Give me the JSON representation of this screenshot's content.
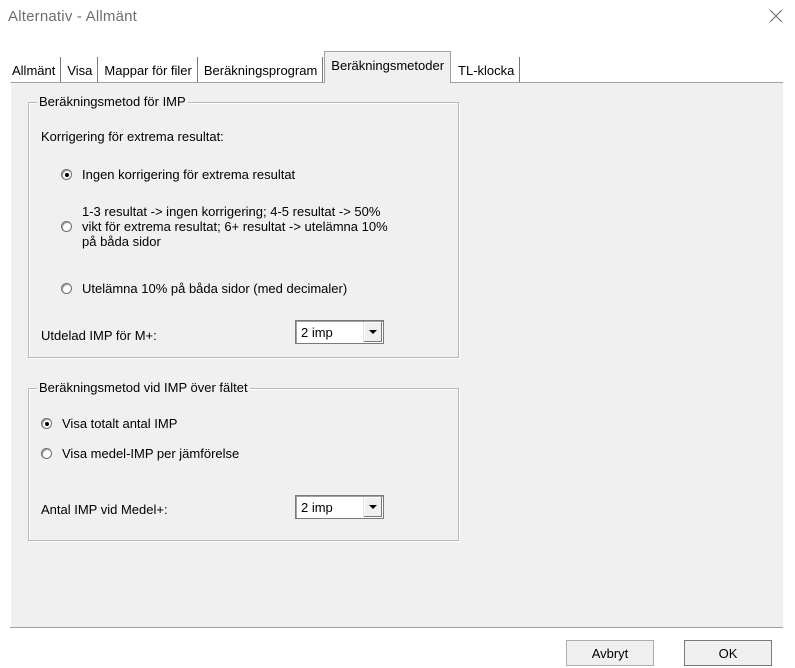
{
  "window": {
    "title": "Alternativ - Allmänt",
    "close_glyph": "✕"
  },
  "tabs": [
    {
      "label": "Allmänt",
      "active": false
    },
    {
      "label": "Visa",
      "active": false
    },
    {
      "label": "Mappar för filer",
      "active": false
    },
    {
      "label": "Beräkningsprogram",
      "active": false
    },
    {
      "label": "Beräkningsmetoder",
      "active": true
    },
    {
      "label": "TL-klocka",
      "active": false
    }
  ],
  "imp_group": {
    "legend": "Beräkningsmetod för IMP",
    "subheading": "Korrigering för extrema resultat:",
    "options": [
      {
        "line1": "Ingen korrigering för extrema resultat",
        "checked": true
      },
      {
        "line1": "1-3 resultat -> ingen korrigering; 4-5 resultat -> 50%",
        "line2": "vikt för extrema resultat; 6+ resultat -> utelämna 10%",
        "line3": "på båda sidor",
        "checked": false
      },
      {
        "line1": "Utelämna 10% på båda sidor (med decimaler)",
        "checked": false
      }
    ],
    "select_label": "Utdelad IMP för M+:",
    "select_value": "2 imp"
  },
  "field_group": {
    "legend": "Beräkningsmetod vid IMP över fältet",
    "options": [
      {
        "line1": "Visa totalt antal IMP",
        "checked": true
      },
      {
        "line1": "Visa medel-IMP per jämförelse",
        "checked": false
      }
    ],
    "select_label": "Antal IMP vid Medel+:",
    "select_value": "2 imp"
  },
  "buttons": {
    "cancel": "Avbryt",
    "ok": "OK"
  }
}
